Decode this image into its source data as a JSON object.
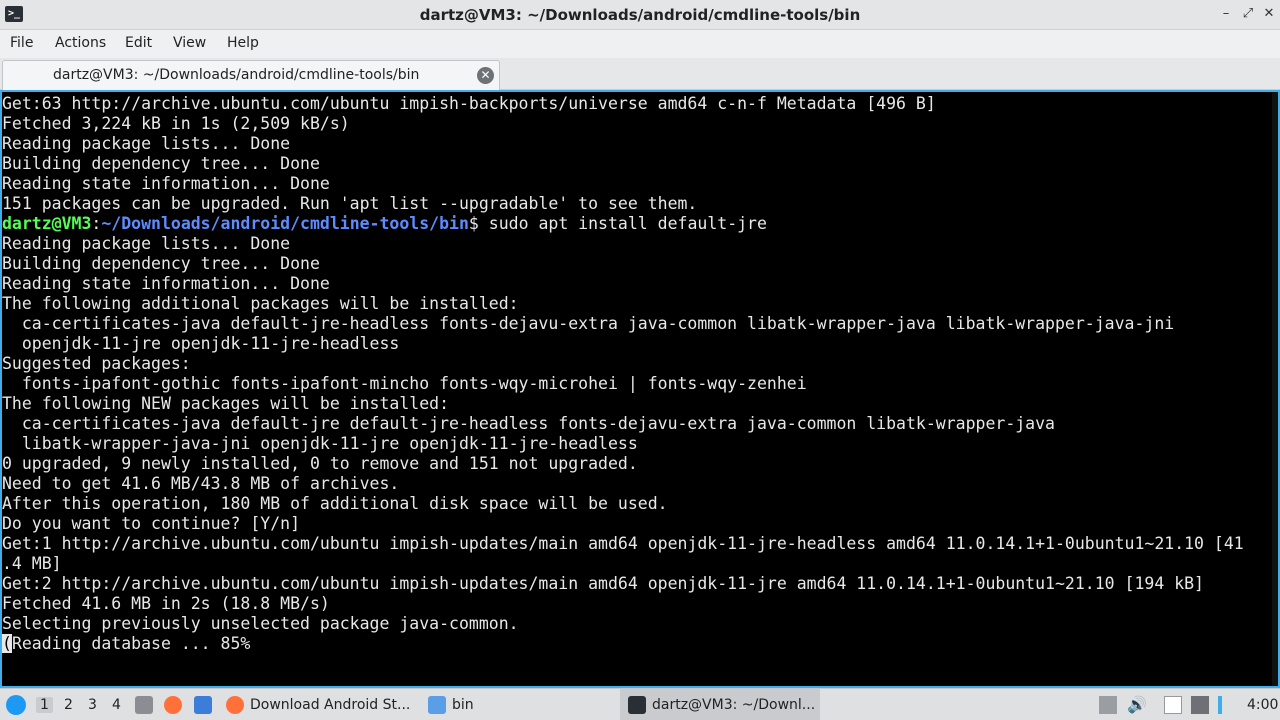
{
  "window": {
    "title": "dartz@VM3: ~/Downloads/android/cmdline-tools/bin"
  },
  "menu": [
    "File",
    "Actions",
    "Edit",
    "View",
    "Help"
  ],
  "tab": {
    "label": "dartz@VM3: ~/Downloads/android/cmdline-tools/bin"
  },
  "terminal": {
    "lines": [
      "Get:63 http://archive.ubuntu.com/ubuntu impish-backports/universe amd64 c-n-f Metadata [496 B]",
      "Fetched 3,224 kB in 1s (2,509 kB/s)",
      "Reading package lists... Done",
      "Building dependency tree... Done",
      "Reading state information... Done",
      "151 packages can be upgraded. Run 'apt list --upgradable' to see them.",
      "__PROMPT__",
      "Reading package lists... Done",
      "Building dependency tree... Done",
      "Reading state information... Done",
      "The following additional packages will be installed:",
      "  ca-certificates-java default-jre-headless fonts-dejavu-extra java-common libatk-wrapper-java libatk-wrapper-java-jni",
      "  openjdk-11-jre openjdk-11-jre-headless",
      "Suggested packages:",
      "  fonts-ipafont-gothic fonts-ipafont-mincho fonts-wqy-microhei | fonts-wqy-zenhei",
      "The following NEW packages will be installed:",
      "  ca-certificates-java default-jre default-jre-headless fonts-dejavu-extra java-common libatk-wrapper-java",
      "  libatk-wrapper-java-jni openjdk-11-jre openjdk-11-jre-headless",
      "0 upgraded, 9 newly installed, 0 to remove and 151 not upgraded.",
      "Need to get 41.6 MB/43.8 MB of archives.",
      "After this operation, 180 MB of additional disk space will be used.",
      "Do you want to continue? [Y/n]",
      "Get:1 http://archive.ubuntu.com/ubuntu impish-updates/main amd64 openjdk-11-jre-headless amd64 11.0.14.1+1-0ubuntu1~21.10 [41",
      ".4 MB]",
      "Get:2 http://archive.ubuntu.com/ubuntu impish-updates/main amd64 openjdk-11-jre amd64 11.0.14.1+1-0ubuntu1~21.10 [194 kB]",
      "Fetched 41.6 MB in 2s (18.8 MB/s)",
      "Selecting previously unselected package java-common.",
      "__LAST__"
    ],
    "prompt_user": "dartz@VM3",
    "prompt_sep": ":",
    "prompt_path": "~/Downloads/android/cmdline-tools/bin",
    "prompt_symbol": "$",
    "prompt_command": " sudo apt install default-jre",
    "last_cursor": "(",
    "last_rest": "Reading database ... 85%"
  },
  "taskbar": {
    "desktops": [
      "1",
      "2",
      "3",
      "4"
    ],
    "tasks": [
      {
        "label": "Download Android St...",
        "icon": "firefox-icon"
      },
      {
        "label": "bin",
        "icon": "folder-icon"
      },
      {
        "label": "dartz@VM3: ~/Downl...",
        "icon": "terminal-icon"
      }
    ],
    "clock": "4:00"
  },
  "colors": {
    "accent": "#3daee9",
    "prompt_user": "#54ff54",
    "prompt_path": "#5c8cff"
  }
}
